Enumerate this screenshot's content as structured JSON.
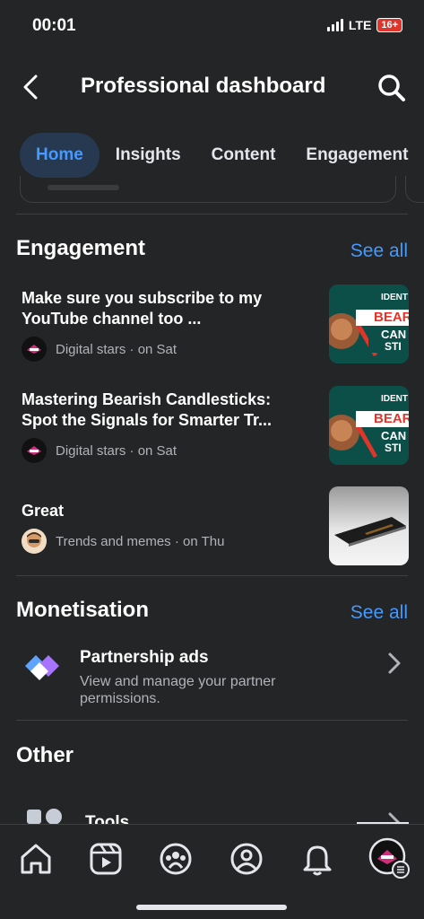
{
  "status": {
    "time": "00:01",
    "network": "LTE",
    "battery": "16+"
  },
  "header": {
    "title": "Professional dashboard"
  },
  "tabs": [
    {
      "label": "Home",
      "active": true
    },
    {
      "label": "Insights"
    },
    {
      "label": "Content"
    },
    {
      "label": "Engagement"
    }
  ],
  "engagement": {
    "title": "Engagement",
    "see_all": "See all",
    "posts": [
      {
        "text": "Make sure you subscribe to my YouTube channel too ...",
        "line1": "Make sure you subscribe to my",
        "line2": "YouTube channel too ...",
        "author": "Digital stars",
        "when": "· on Sat",
        "thumb_lines": [
          "IDENT",
          "BEAR",
          "CAN",
          "STI"
        ]
      },
      {
        "text": "Mastering Bearish Candlesticks: Spot the Signals for Smarter Tr...",
        "line1": "Mastering Bearish Candlesticks:",
        "line2": "Spot the Signals for Smarter Tr...",
        "author": "Digital stars",
        "when": "· on Sat",
        "thumb_lines": [
          "IDENT",
          "BEAR",
          "CAN",
          "STI"
        ]
      },
      {
        "text": "Great",
        "line1": "Great",
        "line2": "",
        "author": "Trends and memes",
        "when": "· on Thu"
      }
    ]
  },
  "monetisation": {
    "title": "Monetisation",
    "see_all": "See all",
    "item": {
      "title": "Partnership ads",
      "subtitle": "View and manage your partner permissions."
    }
  },
  "other": {
    "title": "Other",
    "item": {
      "title": "Tools"
    }
  },
  "colors": {
    "accent": "#4599ff",
    "background": "#242526",
    "tab_active_bg": "#263951"
  },
  "bottom_nav": [
    "home-icon",
    "reels-icon",
    "groups-icon",
    "profile-icon",
    "notifications-icon",
    "menu-avatar"
  ]
}
